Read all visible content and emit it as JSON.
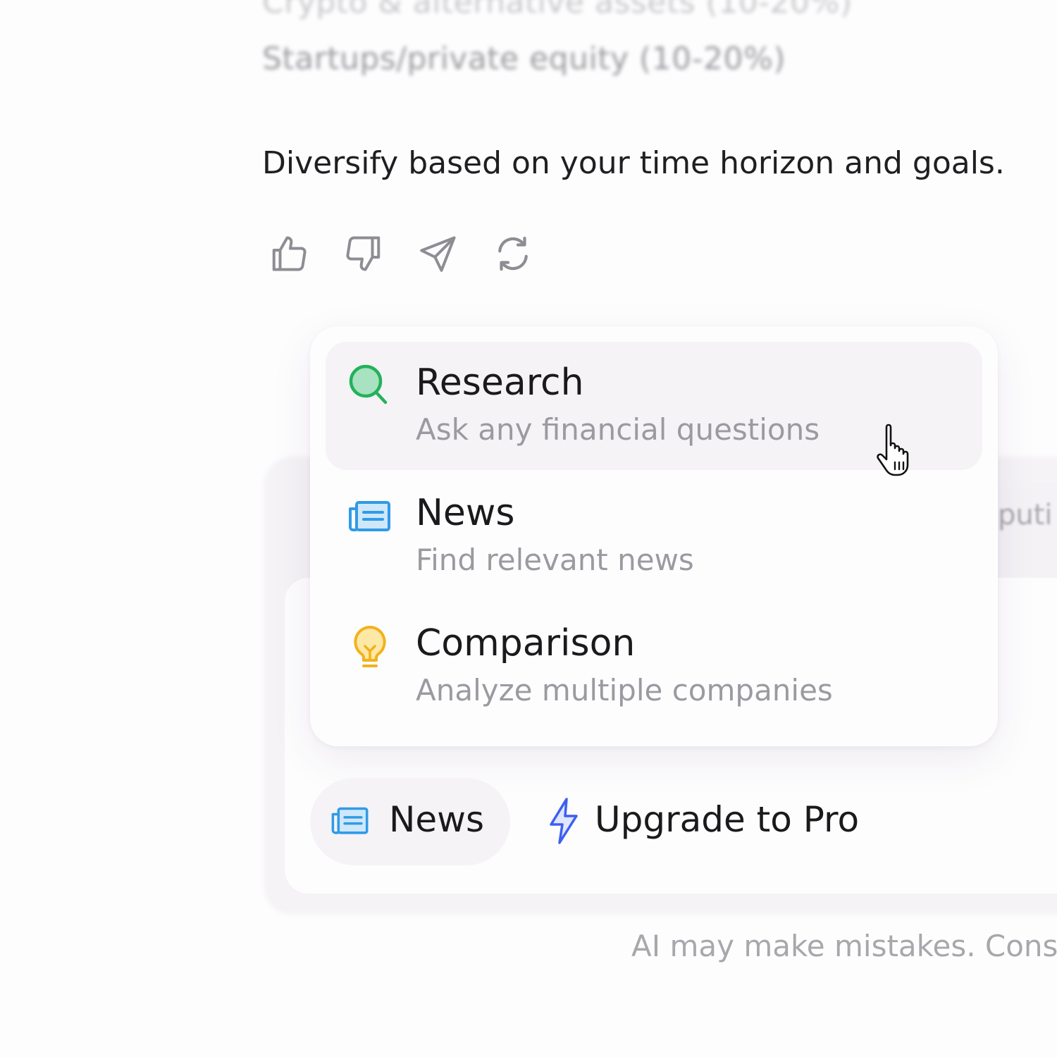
{
  "previous_lines": [
    "Crypto & alternative assets (10-20%)",
    "Startups/private equity (10-20%)"
  ],
  "message": {
    "text": "Diversify based on your time horizon and goals."
  },
  "feedback_actions": [
    {
      "icon": "thumbs-up-icon"
    },
    {
      "icon": "thumbs-down-icon"
    },
    {
      "icon": "send-icon"
    },
    {
      "icon": "regenerate-icon"
    }
  ],
  "composer": {
    "placeholder_fragment": "puti"
  },
  "menu": {
    "items": [
      {
        "title": "Research",
        "subtitle": "Ask any financial questions",
        "icon": "search-icon",
        "color": "#22b25a",
        "active": true
      },
      {
        "title": "News",
        "subtitle": "Find relevant news",
        "icon": "newspaper-icon",
        "color": "#2f9be6",
        "active": false
      },
      {
        "title": "Comparison",
        "subtitle": "Analyze multiple companies",
        "icon": "lightbulb-icon",
        "color": "#f2b21c",
        "active": false
      }
    ]
  },
  "toolbar": {
    "selected_tool": {
      "label": "News",
      "icon": "newspaper-icon",
      "color": "#2f9be6"
    },
    "upgrade": {
      "label": "Upgrade to Pro",
      "icon": "lightning-icon",
      "color": "#3d5ff0"
    }
  },
  "footer": {
    "disclaimer": "AI may make mistakes. Consi"
  },
  "colors": {
    "icon_gray": "#8e8d93",
    "text_primary": "#1a1a1d",
    "text_secondary": "#9b9aa0",
    "active_bg": "#f5f3f6"
  }
}
